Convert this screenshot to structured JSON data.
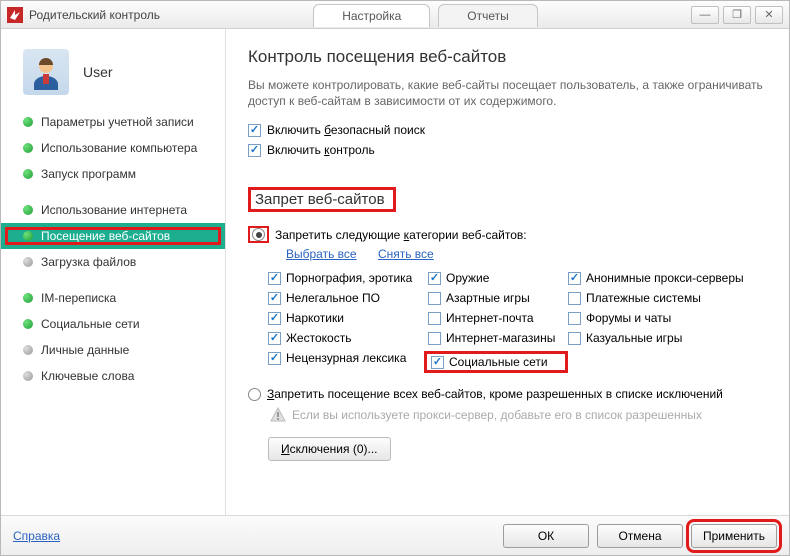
{
  "window": {
    "title": "Родительский контроль"
  },
  "tabs": {
    "settings": "Настройка",
    "reports": "Отчеты"
  },
  "winbtns": {
    "min": "—",
    "max": "❐",
    "close": "✕"
  },
  "user": {
    "name": "User"
  },
  "sidebar": {
    "items": [
      {
        "label": "Параметры учетной записи",
        "dot": "green"
      },
      {
        "label": "Использование компьютера",
        "dot": "green"
      },
      {
        "label": "Запуск программ",
        "dot": "green"
      },
      {
        "label": "Использование интернета",
        "dot": "green"
      },
      {
        "label": "Посещение веб-сайтов",
        "dot": "green",
        "selected": true,
        "highlight": true
      },
      {
        "label": "Загрузка файлов",
        "dot": "grey"
      },
      {
        "label": "IM-переписка",
        "dot": "green"
      },
      {
        "label": "Социальные сети",
        "dot": "green"
      },
      {
        "label": "Личные данные",
        "dot": "grey"
      },
      {
        "label": "Ключевые слова",
        "dot": "grey"
      }
    ]
  },
  "main": {
    "heading": "Контроль посещения веб-сайтов",
    "description": "Вы можете контролировать, какие веб-сайты посещает пользователь, а также ограничивать доступ к веб-сайтам в зависимости от их содержимого.",
    "safe_search_label": "Включить безопасный поиск",
    "enable_control_label": "Включить контроль",
    "block_section": "Запрет веб-сайтов",
    "radio_block_categories": "Запретить следующие категории веб-сайтов:",
    "select_all": "Выбрать все",
    "clear_all": "Снять все",
    "categories": {
      "col1": [
        {
          "label": "Порнография, эротика",
          "checked": true
        },
        {
          "label": "Нелегальное ПО",
          "checked": true
        },
        {
          "label": "Наркотики",
          "checked": true
        },
        {
          "label": "Жестокость",
          "checked": true
        },
        {
          "label": "Нецензурная лексика",
          "checked": true
        }
      ],
      "col2": [
        {
          "label": "Оружие",
          "checked": true
        },
        {
          "label": "Азартные игры",
          "checked": false
        },
        {
          "label": "Интернет-почта",
          "checked": false
        },
        {
          "label": "Интернет-магазины",
          "checked": false
        },
        {
          "label": "Социальные сети",
          "checked": true,
          "highlight": true
        }
      ],
      "col3": [
        {
          "label": "Анонимные прокси-серверы",
          "checked": true
        },
        {
          "label": "Платежные системы",
          "checked": false
        },
        {
          "label": "Форумы и чаты",
          "checked": false
        },
        {
          "label": "Казуальные игры",
          "checked": false
        }
      ]
    },
    "radio_block_all": "Запретить посещение всех веб-сайтов, кроме разрешенных в списке исключений",
    "proxy_warning": "Если вы используете прокси-сервер, добавьте его в список разрешенных",
    "exclusions_btn": "Исключения (0)..."
  },
  "footer": {
    "help": "Справка",
    "ok": "ОК",
    "cancel": "Отмена",
    "apply": "Применить"
  },
  "colors": {
    "highlight": "#e11b1b",
    "accent": "#1cae8f",
    "link": "#2a63c0"
  }
}
